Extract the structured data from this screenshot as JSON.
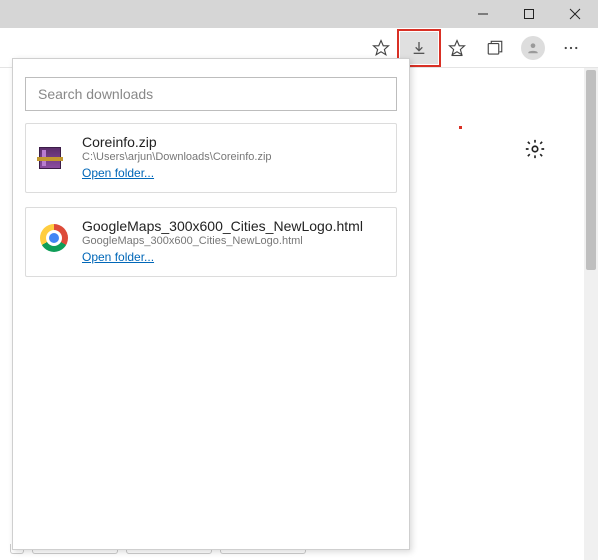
{
  "search": {
    "placeholder": "Search downloads"
  },
  "open_folder_label": "Open folder...",
  "downloads": [
    {
      "icon": "winrar",
      "name": "Coreinfo.zip",
      "path": "C:\\Users\\arjun\\Downloads\\Coreinfo.zip"
    },
    {
      "icon": "chrome",
      "name": "GoogleMaps_300x600_Cities_NewLogo.html",
      "path": "GoogleMaps_300x600_Cities_NewLogo.html"
    }
  ],
  "stubs": [
    14,
    86,
    86,
    86
  ]
}
